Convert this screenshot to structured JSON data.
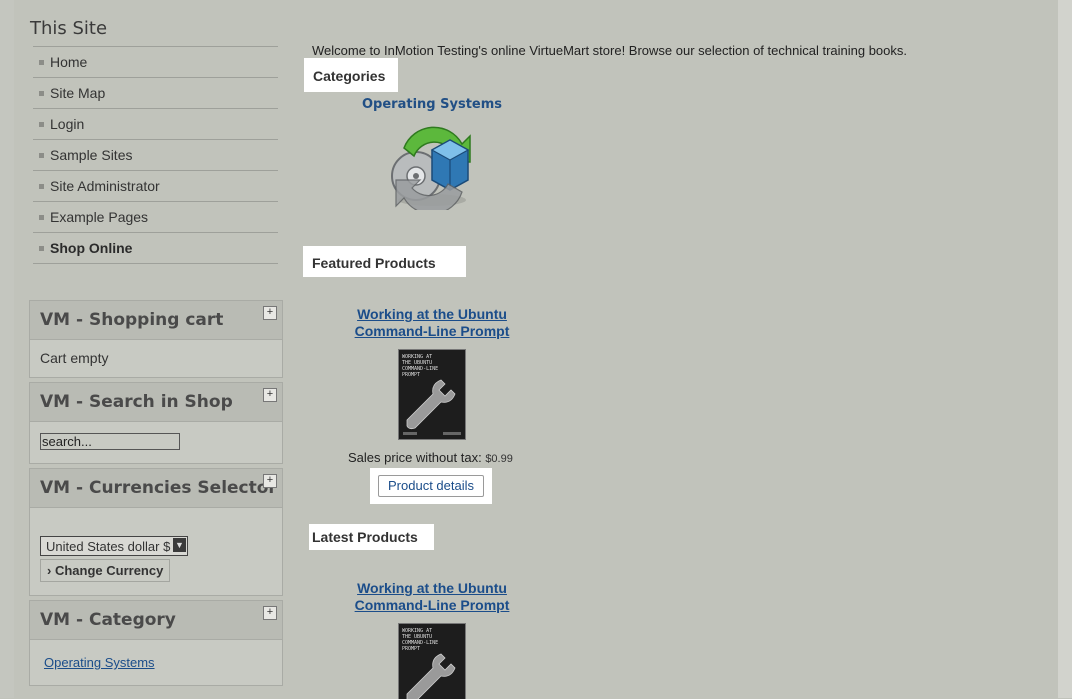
{
  "sidebar": {
    "site_title": "This Site",
    "menu": [
      {
        "label": "Home"
      },
      {
        "label": "Site Map"
      },
      {
        "label": "Login"
      },
      {
        "label": "Sample Sites"
      },
      {
        "label": "Site Administrator"
      },
      {
        "label": "Example Pages"
      },
      {
        "label": "Shop Online"
      }
    ],
    "modules": {
      "cart": {
        "title": "VM - Shopping cart",
        "toggle": "+",
        "body": "Cart empty"
      },
      "search": {
        "title": "VM - Search in Shop",
        "toggle": "+",
        "value": "search..."
      },
      "currency": {
        "title": "VM - Currencies Selector",
        "toggle": "+",
        "selected": "United States dollar $",
        "button": "Change Currency",
        "button_arrow": "›"
      },
      "category": {
        "title": "VM - Category",
        "toggle": "+",
        "link": "Operating Systems"
      }
    }
  },
  "main": {
    "welcome": "Welcome to InMotion Testing's online VirtueMart store! Browse our selection of technical training books.",
    "categories_heading": "Categories",
    "category": {
      "name": "Operating Systems",
      "icon": "os-category-icon"
    },
    "featured_heading": "Featured Products",
    "featured": {
      "title_line1": "Working at the Ubuntu",
      "title_line2": "Command-Line Prompt",
      "price_label": "Sales price without tax:",
      "price": "$0.99",
      "details_button": "Product details"
    },
    "latest_heading": "Latest Products",
    "latest": {
      "title_line1": "Working at the Ubuntu",
      "title_line2": "Command-Line Prompt"
    },
    "book_cover_text": [
      "WORKING AT",
      "THE UBUNTU",
      "COMMAND-LINE",
      "PROMPT"
    ]
  }
}
